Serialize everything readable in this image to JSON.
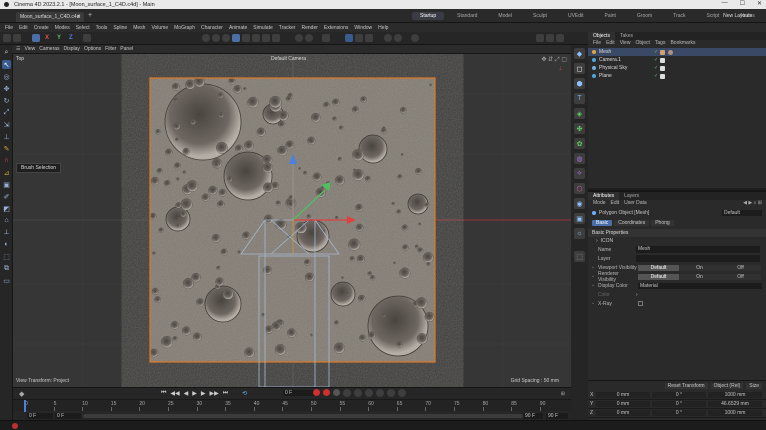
{
  "window": {
    "title": "Cinema 4D 2023.2.1 - [Moon_surface_1_C4D.c4d] - Main"
  },
  "doc_tab": {
    "label": "Moon_surface_1_C4D.c4d"
  },
  "layouts": [
    {
      "label": "Startup",
      "active": true
    },
    {
      "label": "Standard"
    },
    {
      "label": "Model"
    },
    {
      "label": "Sculpt"
    },
    {
      "label": "UVEdit"
    },
    {
      "label": "Paint"
    },
    {
      "label": "Groom"
    },
    {
      "label": "Track"
    },
    {
      "label": "Script"
    },
    {
      "label": "Nodes"
    }
  ],
  "new_layouts": "New Layouts",
  "menu": [
    "File",
    "Edit",
    "Create",
    "Modes",
    "Select",
    "Tools",
    "Spline",
    "Mesh",
    "Volume",
    "MoGraph",
    "Character",
    "Animate",
    "Simulate",
    "Tracker",
    "Render",
    "Extensions",
    "Window",
    "Help"
  ],
  "axis_locks": [
    "X",
    "Y",
    "Z"
  ],
  "viewport_menu": [
    "View",
    "Cameras",
    "Display",
    "Options",
    "Filter",
    "Panel"
  ],
  "viewport": {
    "name": "Top",
    "camera": "Default Camera",
    "transform": "View Transform: Project",
    "grid": "Grid Spacing : 50 mm",
    "tooltip": "Brush Selection"
  },
  "timeline": {
    "ticks": [
      "0",
      "5",
      "10",
      "15",
      "20",
      "25",
      "30",
      "35",
      "40",
      "45",
      "50",
      "55",
      "60",
      "65",
      "70",
      "75",
      "80",
      "85",
      "90"
    ],
    "current": "0 F",
    "start": "0 F",
    "start2": "0 F",
    "end": "90 F",
    "end2": "90 F",
    "frame": "0 F"
  },
  "objects_panel": {
    "tabs": [
      {
        "label": "Objects",
        "on": true
      },
      {
        "label": "Takes"
      }
    ],
    "menu": [
      "File",
      "Edit",
      "View",
      "Object",
      "Tags",
      "Bookmarks"
    ],
    "items": [
      {
        "name": "Mesh",
        "selected": true,
        "color": "#e8a040"
      },
      {
        "name": "Camera.1",
        "selected": false,
        "color": "#4aa8e0"
      },
      {
        "name": "Physical Sky",
        "selected": false,
        "color": "#6fb0e0"
      },
      {
        "name": "Plane",
        "selected": false,
        "color": "#4aa8e0"
      }
    ]
  },
  "attributes_panel": {
    "tabs": [
      {
        "label": "Attributes",
        "on": true
      },
      {
        "label": "Layers"
      }
    ],
    "menu": [
      "Mode",
      "Edit",
      "User Data"
    ],
    "object_type": "Polygon Object [Mesh]",
    "mode_select": "Default",
    "subtabs": [
      {
        "label": "Basic",
        "on": true
      },
      {
        "label": "Coordinates"
      },
      {
        "label": "Phong"
      }
    ],
    "section": "Basic Properties",
    "icon_label": "ICON",
    "props": [
      {
        "label": "Name",
        "value": "Mesh"
      },
      {
        "label": "Layer",
        "value": ""
      }
    ],
    "visibility": [
      {
        "label": "Viewport Visibility",
        "opts": [
          "Default",
          "On",
          "Off"
        ]
      },
      {
        "label": "Renderer Visibility",
        "opts": [
          "Default",
          "On",
          "Off"
        ]
      }
    ],
    "display_color": {
      "label": "Display Color",
      "value": "Material"
    },
    "color_label": "Color",
    "xray_label": "X-Ray"
  },
  "coords": {
    "buttons": [
      "Reset Transform",
      "Object (Rel)",
      "Size"
    ],
    "rows": [
      {
        "axis": "X",
        "pos": "0 mm",
        "rot": "0 °",
        "size": "1000 mm"
      },
      {
        "axis": "Y",
        "pos": "0 mm",
        "rot": "0 °",
        "size": "46.6529 mm"
      },
      {
        "axis": "Z",
        "pos": "0 mm",
        "rot": "0 °",
        "size": "1000 mm"
      }
    ]
  }
}
